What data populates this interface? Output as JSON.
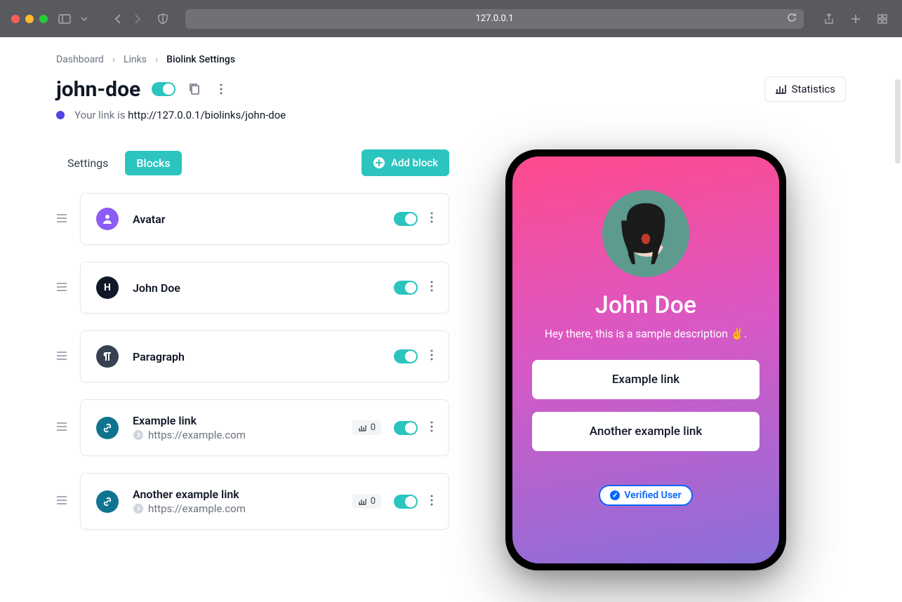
{
  "chrome": {
    "url": "127.0.0.1"
  },
  "breadcrumb": {
    "items": [
      "Dashboard",
      "Links",
      "Biolink Settings"
    ]
  },
  "header": {
    "title": "john-doe",
    "stats_label": "Statistics"
  },
  "link_info": {
    "prefix": "Your link is ",
    "url": "http://127.0.0.1/biolinks/john-doe"
  },
  "tabs": {
    "settings": "Settings",
    "blocks": "Blocks",
    "add_block": "Add block"
  },
  "blocks": [
    {
      "icon": "avatar",
      "title": "Avatar",
      "sub": null,
      "count": null
    },
    {
      "icon": "heading",
      "title": "John Doe",
      "sub": null,
      "count": null
    },
    {
      "icon": "paragraph",
      "title": "Paragraph",
      "sub": null,
      "count": null
    },
    {
      "icon": "link",
      "title": "Example link",
      "sub": "https://example.com",
      "count": "0"
    },
    {
      "icon": "link",
      "title": "Another example link",
      "sub": "https://example.com",
      "count": "0"
    }
  ],
  "preview": {
    "name": "John Doe",
    "description": "Hey there, this is a sample description ✌️.",
    "links": [
      "Example link",
      "Another example link"
    ],
    "badge": "Verified User"
  }
}
